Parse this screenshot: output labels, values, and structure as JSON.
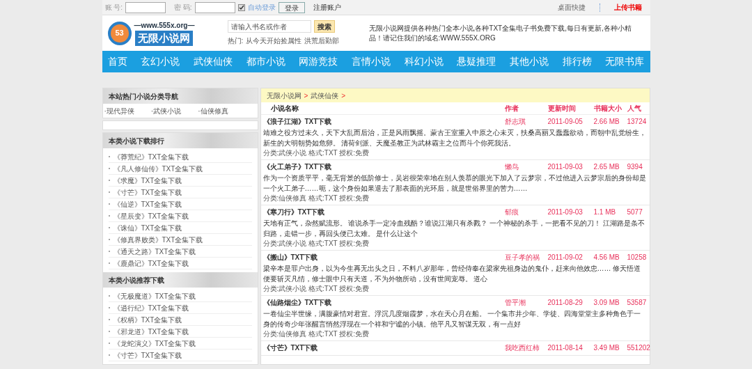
{
  "top_bar": {
    "account_label": "账 号:",
    "password_label": "密 码:",
    "auto_login": {
      "label": "自动登录",
      "checked": true
    },
    "login_button": "登录",
    "register_link": "注册账户",
    "desktop_link": "桌面快捷",
    "upload_link": "上传书籍"
  },
  "header": {
    "logo": {
      "url": "—www.555x.org—",
      "name": "无限小说网",
      "badge": "53"
    },
    "search": {
      "placeholder": "请输入书名或作者",
      "button": "搜索"
    },
    "hot_label": "热门:",
    "hot_links": [
      "从今天开始捡属性",
      "洪荒后勤部"
    ],
    "intro": "无限小说网提供各种热门全本小说,各种TXT全集电子书免费下载,每日有更新,各种小精品！请记住我们的域名:WWW.555X.ORG"
  },
  "nav": [
    "首页",
    "玄幻小说",
    "武侠仙侠",
    "都市小说",
    "网游竞技",
    "言情小说",
    "科幻小说",
    "悬疑推理",
    "其他小说",
    "排行榜",
    "无限书库"
  ],
  "sidebar": {
    "category_nav": {
      "title": "本站热门小说分类导航",
      "links": [
        "·现代异侠",
        "·武侠小说",
        "·仙侠修真"
      ]
    },
    "ranking": {
      "title": "本类小说下载排行",
      "items": [
        "《莽荒纪》TXT全集下载",
        "《凡人修仙传》TXT全集下载",
        "《求魔》TXT全集下载",
        "《寸芒》TXT全集下载",
        "《仙逆》TXT全集下载",
        "《星辰变》TXT全集下载",
        "《诛仙》TXT全集下载",
        "《修真界败类》TXT全集下载",
        "《通天之路》TXT全集下载",
        "《鹿鼎记》TXT全集下载"
      ]
    },
    "recommend": {
      "title": "本类小说推荐下载",
      "items": [
        "《无极魔道》TXT全集下载",
        "《逍行纪》TXT全集下载",
        "《权柄》TXT全集下载",
        "《邪龙道》TXT全集下载",
        "《龙蛇演义》TXT全集下载",
        "《寸芒》TXT全集下载"
      ]
    }
  },
  "breadcrumb": [
    "无限小说网",
    "武侠仙侠"
  ],
  "breadcrumb_separator": ">",
  "table": {
    "columns": [
      "小说名称",
      "作者",
      "更新时间",
      "书籍大小",
      "人气"
    ],
    "rows": [
      {
        "title": "《浪子江湖》TXT下载",
        "author": "舒志琪",
        "updated": "2011-09-05",
        "size": "2.66 MB",
        "popularity": "13724",
        "description": "靖难之役方过未久，天下大乱而后治，正是风雨飘摇。蒙古王室重入中原之心未灭，扶桑高丽又蠢蠢欲动，而朝中乱党纷生，新生的大明朝势如危卵。 清荷剑派、天魔圣教正为武林霸主之位而斗个你死我活。",
        "meta": "分类:武侠小说 格式:TXT 授权:免费"
      },
      {
        "title": "《火工弟子》TXT下载",
        "author": "懒鸟",
        "updated": "2011-09-03",
        "size": "2.65 MB",
        "popularity": "9394",
        "description": "作为一个资质平平，毫无背景的低阶修士，吴岩很荣幸地在别人羡慕的眼光下加入了云梦宗，不过他进入云梦宗后的身份却是一个火工弟子……呃，这个身份如果退去了那表面的光环后，就是世俗界里的苦力……",
        "meta": "分类:仙侠修真 格式:TXT 授权:免费"
      },
      {
        "title": "《寒刀行》TXT下载",
        "author": "郁痕",
        "updated": "2011-09-03",
        "size": "1.1 MB",
        "popularity": "5077",
        "description": "天地有正气，杂然赋流形。 谁说杀手一定冷血残酷？谁说江湖只有杀戮？ 一个神秘的杀手，一把看不见的刀！ 江湖路是条不归路，走错一步，再回头便已太难。 是什么让这个",
        "meta": "分类:武侠小说 格式:TXT 授权:免费"
      },
      {
        "title": "《搬山》TXT下载",
        "author": "豆子孝的祸",
        "updated": "2011-09-02",
        "size": "4.56 MB",
        "popularity": "10258",
        "description": "梁辛本是罪户出身，以为今生再无出头之日，不料八岁那年，曾经侍奉在梁家先祖身边的鬼仆，赶来向他效忠…… 修天悟道便要斩灭凡情，修士眼中只有天道，不为外物所动，没有世间宠辱。 道心",
        "meta": "分类:武侠小说 格式:TXT 授权:免费"
      },
      {
        "title": "《仙路烟尘》TXT下载",
        "author": "管平潮",
        "updated": "2011-08-29",
        "size": "3.09 MB",
        "popularity": "53587",
        "description": "一卷仙尘半世缘，满腹豪情对君宣。浮沉几度烟霞梦，水在天心月在船。 一个集市井少年、学徒、四海堂堂主多种角色于一身的传奇少年张醒言悄然浮现在一个祥和宁谧的小镇。他平凡又智谋无双，有一点好",
        "meta": "分类:仙侠修真 格式:TXT 授权:免费"
      },
      {
        "title": "《寸芒》TXT下载",
        "author": "我吃西红柿",
        "updated": "2011-08-14",
        "size": "3.49 MB",
        "popularity": "551202"
      }
    ]
  }
}
